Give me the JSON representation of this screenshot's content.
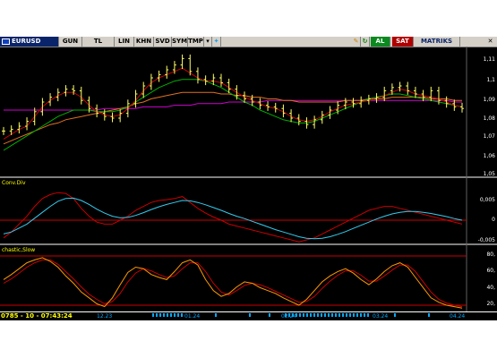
{
  "toolbar": {
    "symbol": "EURUSD",
    "buttons": [
      "GUN",
      "TL",
      "LIN",
      "KHN",
      "SVD",
      "SYM",
      "TMP"
    ],
    "dropdown_icon": "chevron-down-icon",
    "share_icon": "twitter-bird-icon",
    "pencil_icon": "pencil-icon",
    "refresh_icon": "refresh-icon",
    "buy_label": "AL",
    "sell_label": "SAT",
    "matrix_label": "MATRIKS",
    "close_icon": "close-icon"
  },
  "panels": {
    "price": {
      "scale_labels": [
        "1,11",
        "1,1",
        "1,09",
        "1,08",
        "1,07",
        "1,06",
        "1,05"
      ]
    },
    "macd": {
      "label": "Conv.Div",
      "scale_labels": [
        "0,005",
        "0",
        "-0,005"
      ]
    },
    "stochastic": {
      "label": "chastic,Slow",
      "scale_labels": [
        "80,",
        "60,",
        "40,",
        "20,"
      ]
    }
  },
  "status": {
    "clock": "0785 - 10 - 07:43:24",
    "date_labels": [
      "12.23",
      "01.24",
      "02.24",
      "03.24",
      "04.24"
    ]
  },
  "colors": {
    "background": "#000000",
    "bars": "#ffff66",
    "ma_red": "#cc0000",
    "ma_green": "#00b000",
    "ma_orange": "#e07020",
    "ma_magenta": "#d000d0",
    "macd_line": "#cc0000",
    "signal_line": "#33ccee",
    "stoch_k": "#ff9900",
    "stoch_d": "#cc0000",
    "guide": "#cc0000"
  },
  "chart_data": {
    "type": "line",
    "series": [
      {
        "values": [
          1.067,
          1.068,
          1.07,
          1.073,
          1.079,
          1.085,
          1.088,
          1.091,
          1.093,
          1.092,
          1.086,
          1.081,
          1.078,
          1.076,
          1.075,
          1.078,
          1.084,
          1.09,
          1.095,
          1.1,
          1.102,
          1.105,
          1.108,
          1.112,
          1.104,
          1.099,
          1.098,
          1.1,
          1.097,
          1.093,
          1.089,
          1.087,
          1.085,
          1.083,
          1.082,
          1.081,
          1.078,
          1.075,
          1.073,
          1.071,
          1.074,
          1.077,
          1.08,
          1.083,
          1.085,
          1.084,
          1.086,
          1.087,
          1.088,
          1.092,
          1.094,
          1.095,
          1.092,
          1.09,
          1.088,
          1.092,
          1.086,
          1.084,
          1.082,
          1.081
        ]
      },
      {
        "values": [
          1.062,
          1.065,
          1.068,
          1.07,
          1.076,
          1.082,
          1.086,
          1.089,
          1.091,
          1.091,
          1.088,
          1.083,
          1.079,
          1.077,
          1.076,
          1.077,
          1.081,
          1.086,
          1.092,
          1.097,
          1.1,
          1.102,
          1.104,
          1.106,
          1.103,
          1.1,
          1.098,
          1.098,
          1.097,
          1.094,
          1.091,
          1.088,
          1.086,
          1.084,
          1.082,
          1.081,
          1.079,
          1.076,
          1.074,
          1.073,
          1.074,
          1.076,
          1.079,
          1.081,
          1.083,
          1.084,
          1.085,
          1.086,
          1.087,
          1.089,
          1.091,
          1.093,
          1.092,
          1.09,
          1.089,
          1.088,
          1.087,
          1.085,
          1.083,
          1.082
        ]
      },
      {
        "values": [
          1.055,
          1.058,
          1.061,
          1.064,
          1.067,
          1.07,
          1.073,
          1.076,
          1.078,
          1.08,
          1.08,
          1.08,
          1.079,
          1.079,
          1.079,
          1.08,
          1.082,
          1.085,
          1.088,
          1.091,
          1.094,
          1.096,
          1.098,
          1.099,
          1.099,
          1.099,
          1.098,
          1.096,
          1.094,
          1.091,
          1.088,
          1.085,
          1.083,
          1.08,
          1.078,
          1.076,
          1.074,
          1.073,
          1.072,
          1.072,
          1.073,
          1.075,
          1.077,
          1.079,
          1.081,
          1.083,
          1.085,
          1.087,
          1.088,
          1.089,
          1.09,
          1.09,
          1.089,
          1.088,
          1.087,
          1.086,
          1.085,
          1.084,
          1.083,
          1.082
        ]
      },
      {
        "values": [
          1.059,
          1.061,
          1.063,
          1.065,
          1.067,
          1.069,
          1.071,
          1.072,
          1.074,
          1.075,
          1.076,
          1.077,
          1.078,
          1.079,
          1.08,
          1.081,
          1.082,
          1.084,
          1.085,
          1.087,
          1.088,
          1.089,
          1.09,
          1.091,
          1.091,
          1.091,
          1.091,
          1.091,
          1.09,
          1.09,
          1.089,
          1.089,
          1.088,
          1.088,
          1.087,
          1.087,
          1.086,
          1.086,
          1.085,
          1.085,
          1.085,
          1.085,
          1.085,
          1.085,
          1.086,
          1.086,
          1.086,
          1.087,
          1.087,
          1.087,
          1.088,
          1.088,
          1.088,
          1.088,
          1.088,
          1.087,
          1.087,
          1.087,
          1.086,
          1.086
        ]
      },
      {
        "values": [
          1.08,
          1.08,
          1.08,
          1.08,
          1.08,
          1.08,
          1.08,
          1.08,
          1.08,
          1.08,
          1.08,
          1.08,
          1.08,
          1.081,
          1.081,
          1.081,
          1.081,
          1.081,
          1.082,
          1.082,
          1.082,
          1.082,
          1.083,
          1.083,
          1.083,
          1.084,
          1.084,
          1.084,
          1.084,
          1.085,
          1.085,
          1.085,
          1.085,
          1.085,
          1.086,
          1.086,
          1.086,
          1.086,
          1.086,
          1.086,
          1.086,
          1.086,
          1.086,
          1.086,
          1.086,
          1.086,
          1.086,
          1.086,
          1.086,
          1.086,
          1.086,
          1.086,
          1.086,
          1.086,
          1.086,
          1.086,
          1.086,
          1.086,
          1.085,
          1.085
        ]
      },
      {
        "values": [
          -0.0045,
          -0.003,
          -0.001,
          0.001,
          0.0035,
          0.0055,
          0.0065,
          0.007,
          0.0068,
          0.0055,
          0.003,
          0.001,
          -0.0005,
          -0.001,
          -0.001,
          0.0,
          0.001,
          0.0025,
          0.0035,
          0.0045,
          0.005,
          0.0052,
          0.0055,
          0.006,
          0.0045,
          0.003,
          0.0018,
          0.0008,
          0.0,
          -0.001,
          -0.0015,
          -0.002,
          -0.0025,
          -0.003,
          -0.0035,
          -0.004,
          -0.0045,
          -0.005,
          -0.0055,
          -0.005,
          -0.0045,
          -0.0035,
          -0.0025,
          -0.0015,
          -0.0005,
          0.0005,
          0.0015,
          0.0025,
          0.003,
          0.0035,
          0.0035,
          0.003,
          0.0025,
          0.002,
          0.0015,
          0.001,
          0.0005,
          0.0,
          -0.0005,
          -0.001
        ]
      },
      {
        "values": [
          -0.0035,
          -0.003,
          -0.002,
          -0.001,
          0.0005,
          0.002,
          0.0035,
          0.0048,
          0.0055,
          0.0056,
          0.005,
          0.004,
          0.0028,
          0.0018,
          0.001,
          0.0006,
          0.0007,
          0.0012,
          0.0019,
          0.0027,
          0.0034,
          0.004,
          0.0045,
          0.005,
          0.0049,
          0.0045,
          0.0039,
          0.0032,
          0.0025,
          0.0017,
          0.001,
          0.0004,
          -0.0003,
          -0.001,
          -0.0017,
          -0.0024,
          -0.003,
          -0.0036,
          -0.0042,
          -0.0046,
          -0.0047,
          -0.0046,
          -0.0042,
          -0.0036,
          -0.0029,
          -0.0021,
          -0.0013,
          -0.0005,
          0.0003,
          0.001,
          0.0016,
          0.002,
          0.0022,
          0.0022,
          0.002,
          0.0017,
          0.0013,
          0.0009,
          0.0004,
          0.0
        ]
      },
      {
        "values": [
          55,
          62,
          70,
          78,
          82,
          85,
          80,
          72,
          60,
          50,
          38,
          30,
          22,
          18,
          30,
          48,
          65,
          72,
          70,
          62,
          58,
          55,
          66,
          78,
          82,
          75,
          55,
          40,
          32,
          36,
          45,
          52,
          50,
          44,
          40,
          36,
          30,
          25,
          20,
          28,
          40,
          52,
          60,
          66,
          70,
          64,
          55,
          48,
          56,
          66,
          74,
          78,
          72,
          58,
          44,
          30,
          24,
          20,
          18,
          16
        ]
      },
      {
        "values": [
          50,
          56,
          64,
          72,
          78,
          82,
          82,
          76,
          66,
          56,
          45,
          35,
          28,
          22,
          25,
          36,
          52,
          64,
          70,
          67,
          62,
          58,
          60,
          70,
          78,
          78,
          66,
          50,
          38,
          34,
          40,
          47,
          50,
          48,
          44,
          39,
          34,
          29,
          24,
          25,
          32,
          43,
          53,
          61,
          67,
          67,
          61,
          53,
          53,
          60,
          68,
          75,
          75,
          66,
          52,
          38,
          28,
          23,
          20,
          18
        ]
      }
    ]
  }
}
